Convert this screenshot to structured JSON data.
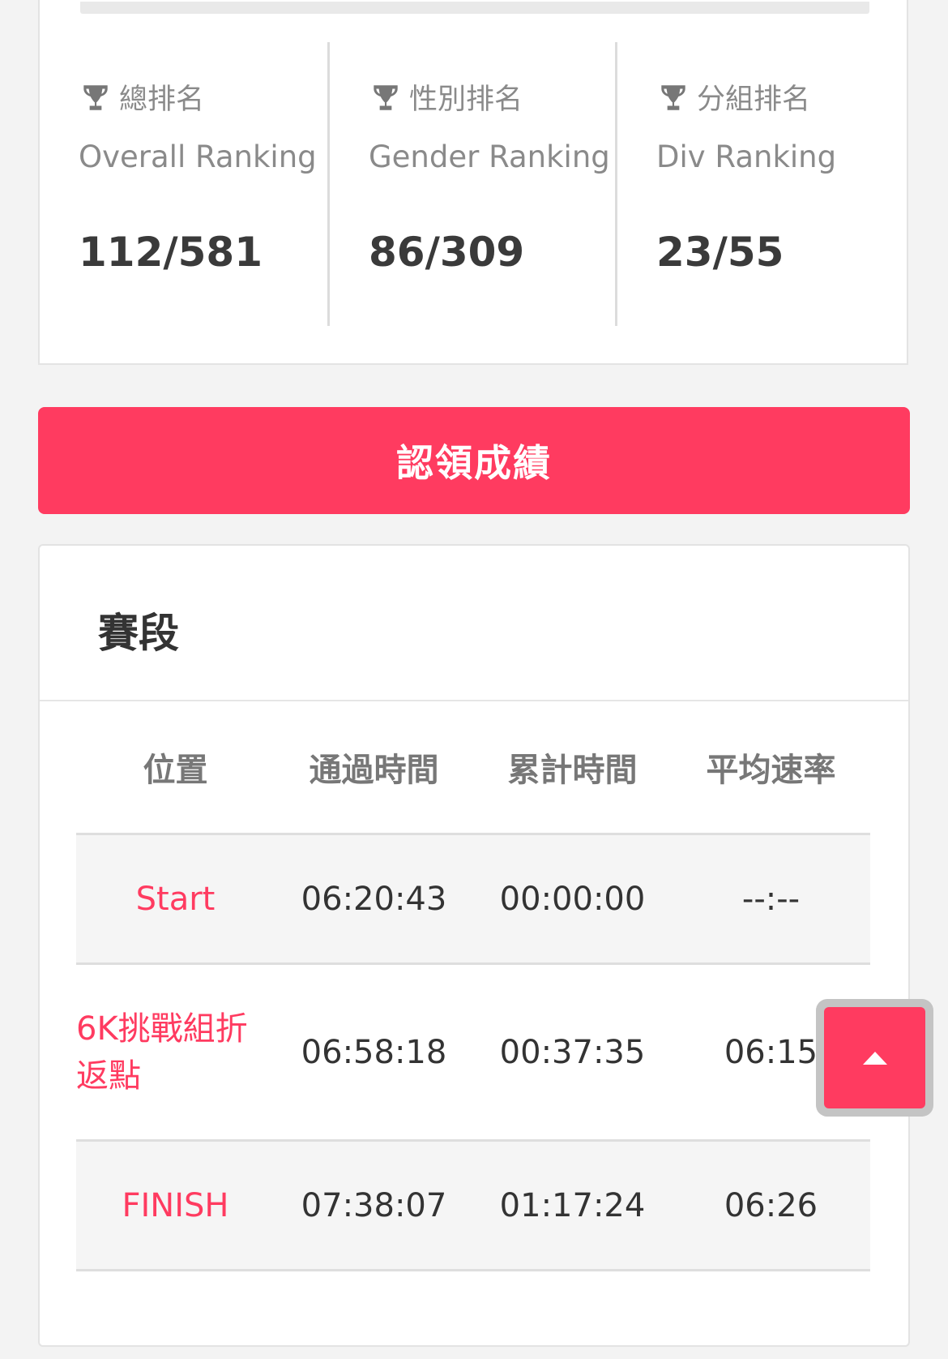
{
  "ranking": {
    "items": [
      {
        "label_zh": "總排名",
        "label_en": "Overall Ranking",
        "value": "112/581"
      },
      {
        "label_zh": "性別排名",
        "label_en": "Gender Ranking",
        "value": "86/309"
      },
      {
        "label_zh": "分組排名",
        "label_en": "Div Ranking",
        "value": "23/55"
      }
    ],
    "icon": "trophy-icon"
  },
  "claim_button": {
    "label": "認領成績"
  },
  "segments": {
    "title": "賽段",
    "columns": [
      "位置",
      "通過時間",
      "累計時間",
      "平均速率"
    ],
    "rows": [
      {
        "position": "Start",
        "pass_time": "06:20:43",
        "cumulative_time": "00:00:00",
        "avg_pace": "--:--"
      },
      {
        "position": "6K挑戰組折返點",
        "pass_time": "06:58:18",
        "cumulative_time": "00:37:35",
        "avg_pace": "06:15"
      },
      {
        "position": "FINISH",
        "pass_time": "07:38:07",
        "cumulative_time": "01:17:24",
        "avg_pace": "06:26"
      }
    ]
  },
  "scroll_top_button": {
    "icon": "caret-up-icon"
  },
  "colors": {
    "accent": "#ff3b60",
    "background": "#f3f3f3",
    "card": "#ffffff",
    "row_alt": "#f5f5f5"
  }
}
